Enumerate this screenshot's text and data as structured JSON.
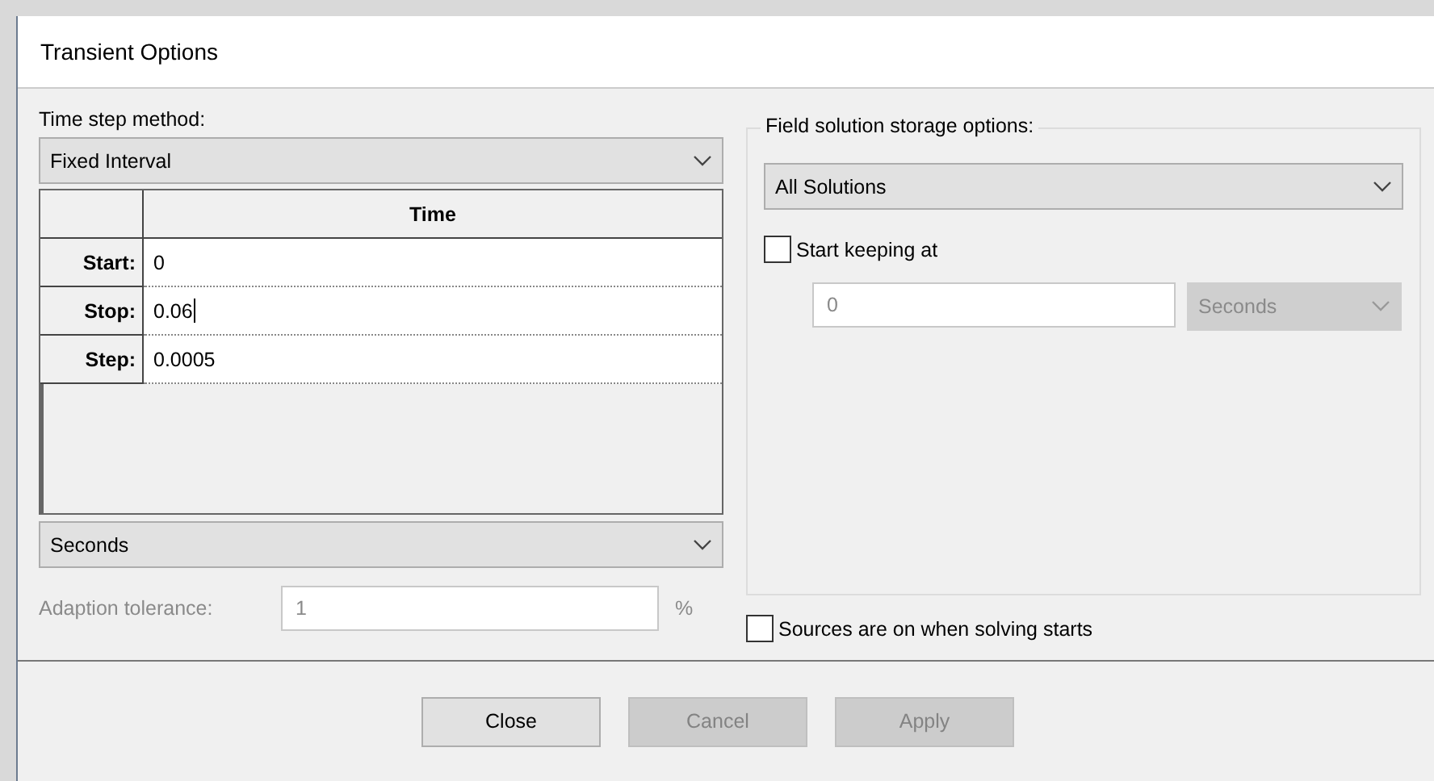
{
  "window": {
    "title": "Transient Options"
  },
  "time_step": {
    "label": "Time step method:",
    "method": "Fixed Interval",
    "table": {
      "column": "Time",
      "rows": [
        {
          "label": "Start:",
          "value": "0",
          "editing": false
        },
        {
          "label": "Stop:",
          "value": "0.06",
          "editing": true
        },
        {
          "label": "Step:",
          "value": "0.0005",
          "editing": false
        }
      ]
    },
    "units": "Seconds",
    "adaption": {
      "label": "Adaption tolerance:",
      "value": "1",
      "unit": "%",
      "disabled": true
    }
  },
  "storage": {
    "label": "Field solution storage options:",
    "option": "All Solutions",
    "start_keeping": {
      "label": "Start keeping at",
      "checked": false,
      "value": "0",
      "units": "Seconds",
      "disabled": true
    }
  },
  "sources": {
    "label": "Sources are on when solving starts",
    "checked": false
  },
  "buttons": [
    {
      "label": "Close",
      "disabled": false
    },
    {
      "label": "Cancel",
      "disabled": true
    },
    {
      "label": "Apply",
      "disabled": true
    }
  ]
}
